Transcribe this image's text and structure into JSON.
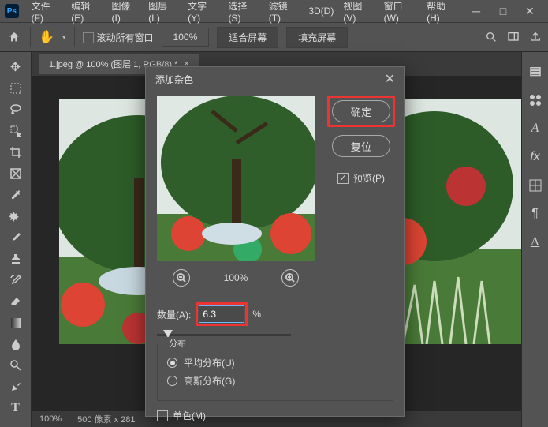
{
  "menu": {
    "items": [
      "文件(F)",
      "编辑(E)",
      "图像(I)",
      "图层(L)",
      "文字(Y)",
      "选择(S)",
      "滤镜(T)",
      "3D(D)",
      "视图(V)",
      "窗口(W)",
      "帮助(H)"
    ]
  },
  "toolbar": {
    "scroll_all": "滚动所有窗口",
    "zoom": "100%",
    "fit": "适合屏幕",
    "fill": "填充屏幕"
  },
  "doc": {
    "tab": "1.jpeg @ 100% (图层 1, RGB/8) *",
    "tab_close": "×"
  },
  "status": {
    "zoom": "100%",
    "dims": "500 像素 x 281"
  },
  "dialog": {
    "title": "添加杂色",
    "ok": "确定",
    "reset": "复位",
    "preview_label": "预览(P)",
    "preview_zoom": "100%",
    "amount_label": "数量(A):",
    "amount_value": "6.3",
    "amount_unit": "%",
    "distribution_label": "分布",
    "dist_uniform": "平均分布(U)",
    "dist_gaussian": "高斯分布(G)",
    "mono_label": "单色(M)"
  }
}
